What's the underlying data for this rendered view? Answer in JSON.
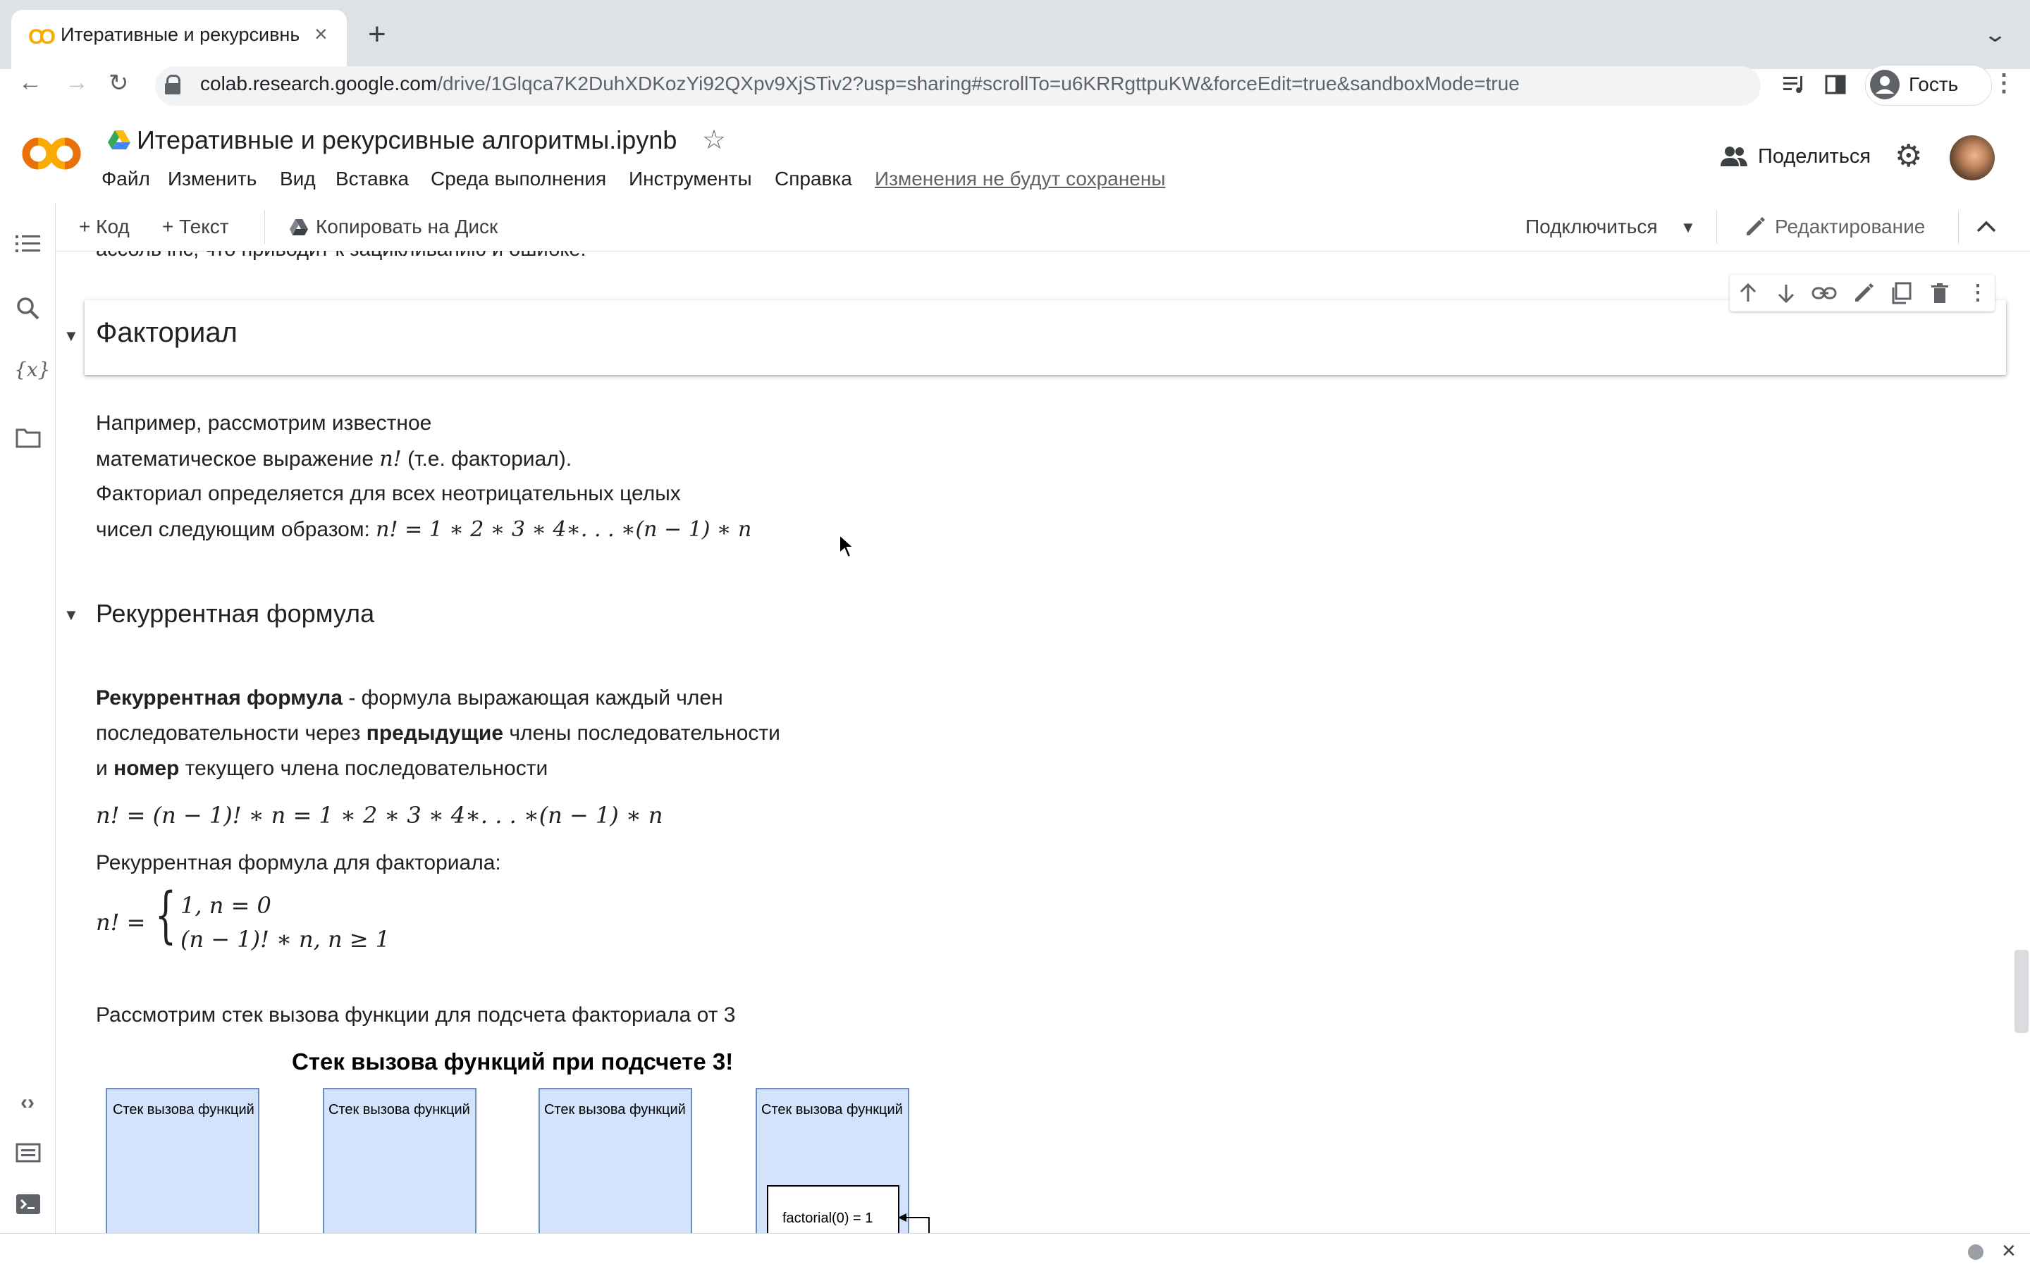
{
  "browser": {
    "tab_title": "Итеративные и рекурсивные а",
    "url_host": "colab.research.google.com",
    "url_path": "/drive/1Glqca7K2DuhXDKozYi92QXpv9XjSTiv2?usp=sharing#scrollTo=u6KRRgttpuKW&forceEdit=true&sandboxMode=true",
    "profile_label": "Гость"
  },
  "colab": {
    "logo_text": "CO",
    "notebook_title": "Итеративные и рекурсивные алгоритмы.ipynb",
    "menu": [
      "Файл",
      "Изменить",
      "Вид",
      "Вставка",
      "Среда выполнения",
      "Инструменты",
      "Справка"
    ],
    "unsaved_notice": "Изменения не будут сохранены",
    "share_label": "Поделиться"
  },
  "left_rail_icons": [
    "table-of-contents-icon",
    "search-icon",
    "variables-icon",
    "files-icon",
    "code-snippets-icon",
    "command-palette-icon",
    "terminal-icon"
  ],
  "notebook_toolbar": {
    "add_code": "+ Код",
    "add_text": "+ Текст",
    "copy_to_drive": "Копировать на Диск",
    "connect": "Подключиться",
    "editing": "Редактирование"
  },
  "cell_toolbar_icons": [
    "move-up-icon",
    "move-down-icon",
    "link-icon",
    "edit-icon",
    "mirror-cell-icon",
    "delete-icon",
    "more-icon"
  ],
  "content": {
    "cutoff_line": "ассоль inc, что приводит к зацикливанию и ошибке.",
    "heading_factorial": "Факториал",
    "intro_line1": "Например, рассмотрим известное",
    "intro_line2_pre": "математическое выражение ",
    "intro_line2_math": "n!",
    "intro_line2_post": " (т.е. факториал).",
    "intro_line3": "Факториал определяется для всех неотрицательных целых",
    "intro_line4_pre": "чисел следующим образом: ",
    "intro_formula": "n! = 1 ∗ 2 ∗ 3 ∗ 4∗. . . ∗(n − 1) ∗ n",
    "heading_recurrent": "Рекуррентная формула",
    "def_bold1": "Рекуррентная формула",
    "def_text1": " - формула выражающая каждый член",
    "def_text2_pre": "последовательности через ",
    "def_bold2": "предыдущие",
    "def_text2_post": " члены последовательности",
    "def_text3_pre": "и ",
    "def_bold3": "номер",
    "def_text3_post": " текущего члена последовательности",
    "formula_expand": "n! = (n − 1)! ∗ n = 1 ∗ 2 ∗ 3 ∗ 4∗. . . ∗(n − 1) ∗ n",
    "recurrent_caption": "Рекуррентная формула для факториала:",
    "piecewise_lhs": "n! =",
    "piecewise_case1": "1,  n = 0",
    "piecewise_case2": "(n − 1)! ∗ n,  n ≥ 1",
    "stack_intro": "Рассмотрим стек вызова функции для подсчета факториала от 3"
  },
  "diagram": {
    "title": "Стек вызова функций при подсчете 3!",
    "stack_labels": [
      "Стек вызова функций",
      "Стек вызова функций",
      "Стек вызова функций",
      "Стек вызова функций"
    ],
    "frame_label": "factorial(0) = 1",
    "box_fill": "#d4e3fc",
    "box_stroke": "#6c8ebf"
  }
}
